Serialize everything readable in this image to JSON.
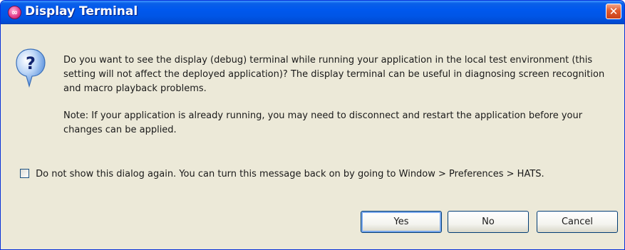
{
  "window": {
    "title": "Display Terminal",
    "title_icon_glyph": "∞",
    "close_glyph": "✕"
  },
  "message": {
    "paragraph1": "Do you want to see the display (debug) terminal while running your application in the local test environment (this setting will not affect the deployed application)? The display terminal can be useful in diagnosing screen recognition and macro playback problems.",
    "paragraph2": "Note: If your application is already running, you may need to disconnect and restart the application before your changes can be applied."
  },
  "checkbox": {
    "label": "Do not show this dialog again. You can turn this message back on by going to Window > Preferences > HATS.",
    "checked": false
  },
  "buttons": {
    "yes": "Yes",
    "no": "No",
    "cancel": "Cancel"
  },
  "colors": {
    "titlebar": "#0055e5",
    "dialog_bg": "#ece9d8",
    "close_button": "#e05a2c",
    "question_bubble": "#4a86d8"
  },
  "icons": {
    "title": "hats-app-icon",
    "dialog": "question-icon",
    "close": "close-icon"
  }
}
